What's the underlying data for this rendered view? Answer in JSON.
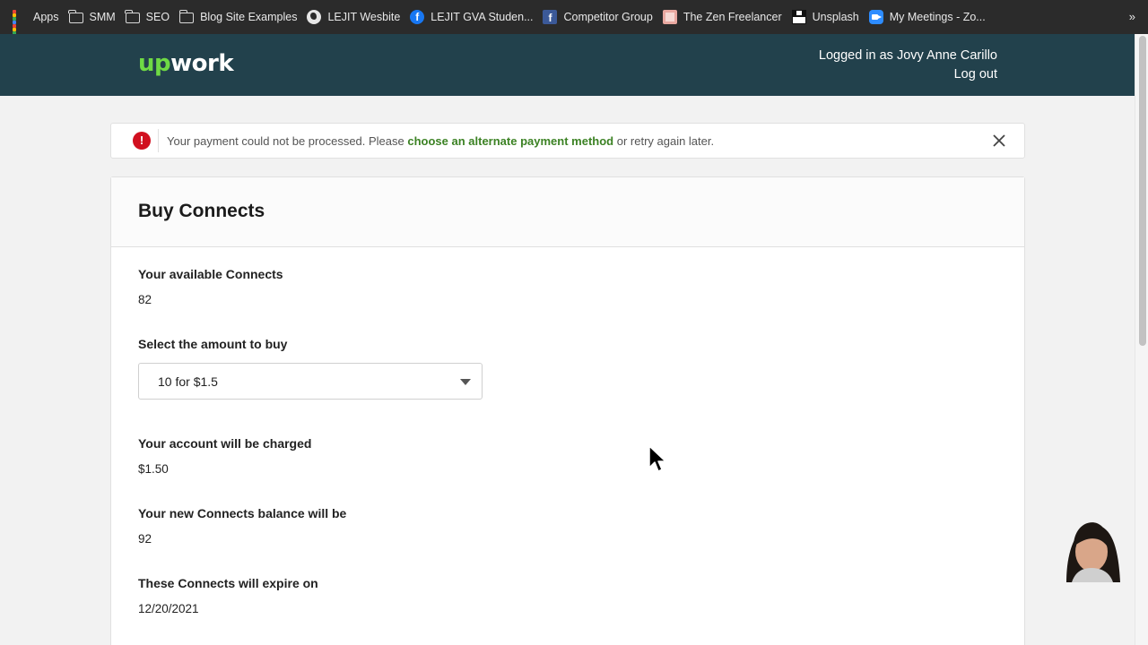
{
  "bookmarks": [
    {
      "label": "Apps",
      "icon": "apps-grid-icon"
    },
    {
      "label": "SMM",
      "icon": "folder-icon"
    },
    {
      "label": "SEO",
      "icon": "folder-icon"
    },
    {
      "label": "Blog Site Examples",
      "icon": "folder-icon"
    },
    {
      "label": "LEJIT Wesbite",
      "icon": "globe-icon"
    },
    {
      "label": "LEJIT GVA Studen...",
      "icon": "facebook-icon"
    },
    {
      "label": "Competitor Group",
      "icon": "facebook-icon"
    },
    {
      "label": "The Zen Freelancer",
      "icon": "site-favicon-icon"
    },
    {
      "label": "Unsplash",
      "icon": "unsplash-icon"
    },
    {
      "label": "My Meetings - Zo...",
      "icon": "zoom-icon"
    }
  ],
  "bookmarks_more": "»",
  "header": {
    "logo_up": "up",
    "logo_work": "work",
    "logged_in": "Logged in as Jovy Anne Carillo",
    "logout": "Log out"
  },
  "alert": {
    "icon": "!",
    "text_before": "Your payment could not be processed. Please ",
    "link": "choose an alternate payment method",
    "text_after": " or retry again later."
  },
  "card": {
    "title": "Buy Connects",
    "available_label": "Your available Connects",
    "available_value": "82",
    "amount_label": "Select the amount to buy",
    "amount_selected": "10 for $1.5",
    "charged_label": "Your account will be charged",
    "charged_value": "$1.50",
    "new_balance_label": "Your new Connects balance will be",
    "new_balance_value": "92",
    "expire_label": "These Connects will expire on",
    "expire_value": "12/20/2021"
  },
  "colors": {
    "header_bg": "#22414c",
    "brand_green": "#6fda44",
    "link_green": "#3c8224",
    "error_red": "#d1101f"
  }
}
